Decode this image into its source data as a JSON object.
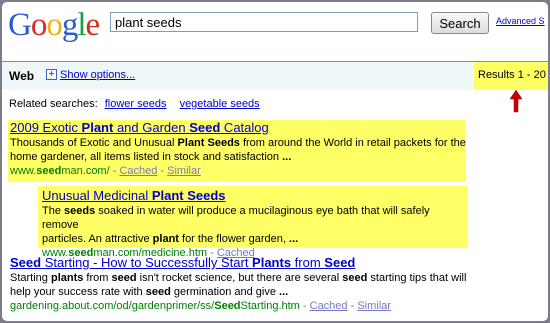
{
  "logo": {
    "text": "Google"
  },
  "search": {
    "query": "plant seeds",
    "button": "Search",
    "advanced": "Advanced S"
  },
  "bar": {
    "web": "Web",
    "plus": "+",
    "show_options": "Show options...",
    "results": "Results 1 - 20"
  },
  "related": {
    "label": "Related searches:",
    "link1": "flower seeds",
    "link2": "vegetable seeds"
  },
  "results": [
    {
      "title_a": "2009 Exotic ",
      "title_b": "Plant",
      "title_c": " and Garden ",
      "title_d": "Seed",
      "title_e": " Catalog",
      "l1a": "Thousands of Exotic and Unusual ",
      "l1b": "Plant Seeds",
      "l1c": " from around the World in retail packets for the",
      "l2a": "home gardener, all items listed in stock and satisfaction ",
      "l2b": "...",
      "url_a": "www.",
      "url_b": "seed",
      "url_c": "man.com/",
      "sep1": " - ",
      "cached": "Cached",
      "sep2": " - ",
      "similar": "Similar"
    },
    {
      "title_a": "Unusual Medicinal ",
      "title_b": "Plant Seeds",
      "l1a": "The ",
      "l1b": "seeds",
      "l1c": " soaked in water will produce a mucilaginous eye bath that will safely remove",
      "l2a": "particles. An attractive ",
      "l2b": "plant",
      "l2c": " for the flower garden, ",
      "l2d": "...",
      "url_a": "www.",
      "url_b": "seed",
      "url_c": "man.com/medicine.htm",
      "sep1": " - ",
      "cached": "Cached"
    },
    {
      "title_a": "Seed",
      "title_b": " Starting - How to Successfully Start ",
      "title_c": "Plants",
      "title_d": " from ",
      "title_e": "Seed",
      "l1a": "Starting ",
      "l1b": "plants",
      "l1c": " from ",
      "l1d": "seed",
      "l1e": " isn't rocket science, but there are several ",
      "l1f": "seed",
      "l1g": " starting tips that will",
      "l2a": "help your success rate with ",
      "l2b": "seed",
      "l2c": " germination and give ",
      "l2d": "...",
      "url_a": "gardening.about.com/od/gardenprimer/ss/",
      "url_b": "Seed",
      "url_c": "Starting.htm",
      "sep1": " - ",
      "cached": "Cached",
      "sep2": " - ",
      "similar": "Similar"
    }
  ],
  "colors": {
    "highlight": "#ffff66",
    "link": "#0000cc",
    "url": "#008000",
    "arrow": "#cc0000"
  }
}
